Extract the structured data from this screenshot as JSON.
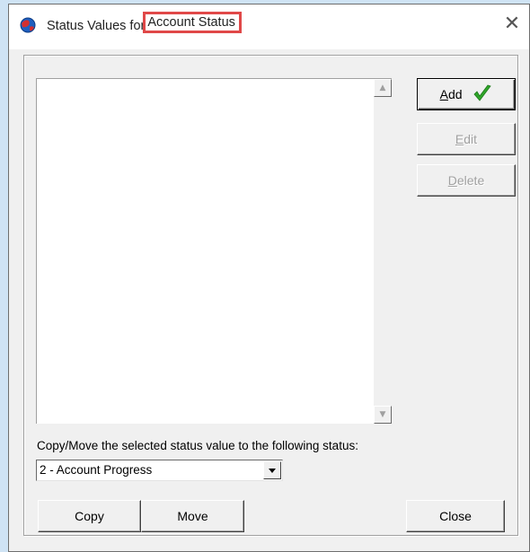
{
  "window": {
    "title_prefix": "Status Values for",
    "title_highlight": "Account Status",
    "close_glyph": "✕"
  },
  "listbox": {
    "items": [],
    "scroll_up_glyph": "▲",
    "scroll_down_glyph": "▼"
  },
  "buttons": {
    "add": {
      "mnemonic": "A",
      "rest": "dd"
    },
    "edit": {
      "mnemonic": "E",
      "rest": "dit"
    },
    "delete": {
      "mnemonic": "D",
      "rest": "elete"
    },
    "copy": "Copy",
    "move": "Move",
    "close": "Close"
  },
  "copy_move": {
    "label": "Copy/Move the selected status value to the following status:",
    "selected_status": "2 - Account Progress"
  },
  "colors": {
    "highlight_border": "#e04848",
    "check_green": "#2fa52a",
    "frame_accent": "#cfe3f4"
  },
  "icons": {
    "app": "globe-icon",
    "add_annotation": "green-check-icon"
  }
}
